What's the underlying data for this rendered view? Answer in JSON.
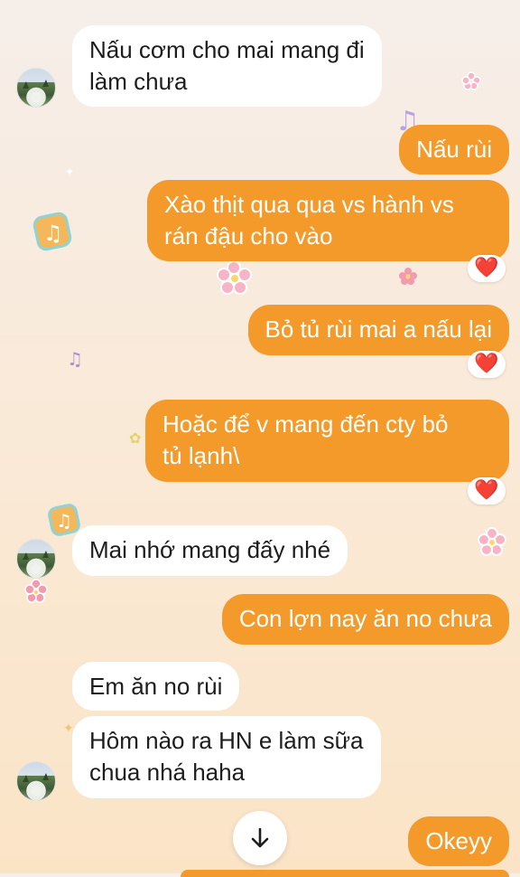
{
  "messages": [
    {
      "side": "in",
      "text": "Nấu cơm cho mai mang đi\nlàm chưa"
    },
    {
      "side": "out",
      "text": "Nấu rùi"
    },
    {
      "side": "out",
      "text": "Xào thịt qua qua vs hành vs\nrán đậu cho vào",
      "reaction": "❤️"
    },
    {
      "side": "out",
      "text": "Bỏ tủ rùi mai a nấu lại",
      "reaction": "❤️"
    },
    {
      "side": "out",
      "text": "Hoặc để v mang đến cty bỏ\ntủ lạnh\\",
      "reaction": "❤️"
    },
    {
      "side": "in",
      "text": "Mai nhớ mang đấy nhé"
    },
    {
      "side": "out",
      "text": "Con lợn nay ăn no chưa"
    },
    {
      "side": "in",
      "text": "Em ăn no rùi"
    },
    {
      "side": "in",
      "text": "Hôm nào ra HN e làm sữa\nchua nhá haha"
    },
    {
      "side": "out",
      "text": "Okeyy"
    }
  ],
  "reaction_icon": "red-heart-icon",
  "scroll_button_icon": "arrow-down-icon",
  "colors": {
    "outgoing_bubble": "#f39a2b",
    "incoming_bubble": "#ffffff",
    "heart": "#e0243a"
  }
}
